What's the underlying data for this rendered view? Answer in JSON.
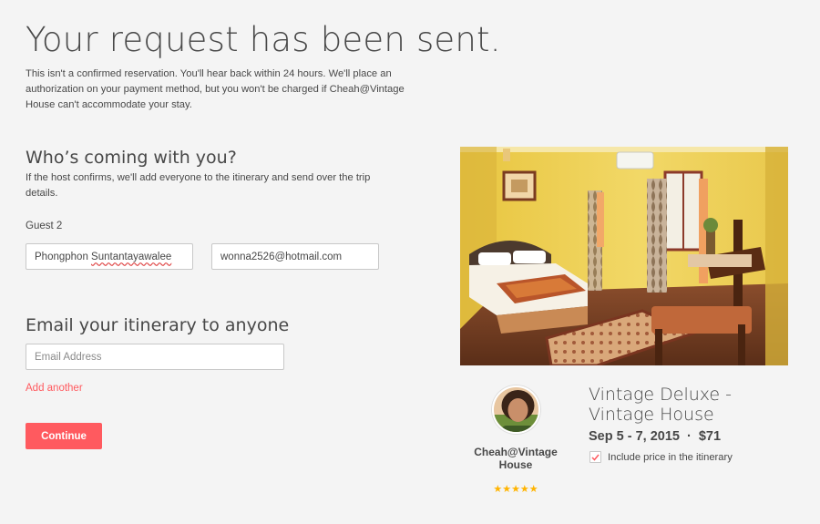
{
  "header": {
    "title": "Your request has been sent.",
    "intro": "This isn't a confirmed reservation. You'll hear back within 24 hours. We'll place an authorization on your payment method, but you won't be charged if Cheah@Vintage House can't accommodate your stay."
  },
  "guests": {
    "title": "Who’s coming with you?",
    "description": "If the host confirms, we'll add everyone to the itinerary and send over the trip details.",
    "guest_label": "Guest 2",
    "name_first": "Phongphon",
    "name_last": "Suntantayawalee",
    "email": "wonna2526@hotmail.com"
  },
  "itinerary": {
    "title": "Email your itinerary to anyone",
    "email_placeholder": "Email Address",
    "add_another": "Add another",
    "continue_label": "Continue"
  },
  "listing": {
    "host_name": "Cheah@Vintage House",
    "rating_stars": "★★★★★",
    "rating": 5,
    "title": "Vintage Deluxe - Vintage House",
    "dates": "Sep 5 - 7, 2015",
    "separator": "·",
    "price": "$71",
    "include_price_label": "Include price in the itinerary",
    "include_price_checked": true
  },
  "colors": {
    "accent": "#ff5a5f",
    "star": "#ffb400",
    "text": "#484848"
  }
}
